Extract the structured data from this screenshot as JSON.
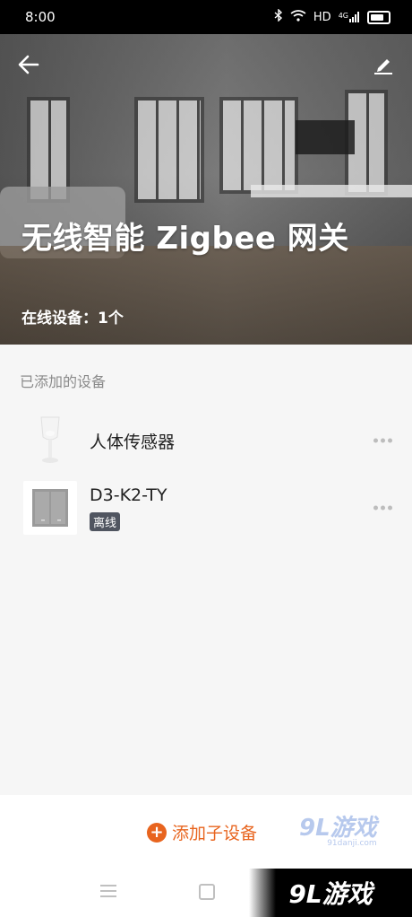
{
  "status_bar": {
    "time": "8:00",
    "icons": [
      "bluetooth-icon",
      "wifi-icon",
      "signal-icon",
      "battery-icon"
    ],
    "hd_label": "HD",
    "network_label": "4G"
  },
  "header": {
    "title": "无线智能 Zigbee 网关",
    "online_devices": "在线设备：1个",
    "back_icon": "back-arrow-icon",
    "edit_icon": "edit-icon"
  },
  "devices_section": {
    "title": "已添加的设备",
    "items": [
      {
        "name": "人体传感器",
        "icon": "motion-sensor-icon",
        "status": ""
      },
      {
        "name": "D3-K2-TY",
        "icon": "wall-switch-icon",
        "status": "离线"
      }
    ]
  },
  "actions": {
    "add_sub_device": "添加子设备"
  },
  "watermark": {
    "logo_text": "9L游戏",
    "site": "91danji.com"
  },
  "colors": {
    "accent": "#e8641e",
    "badge_bg": "#505560"
  }
}
